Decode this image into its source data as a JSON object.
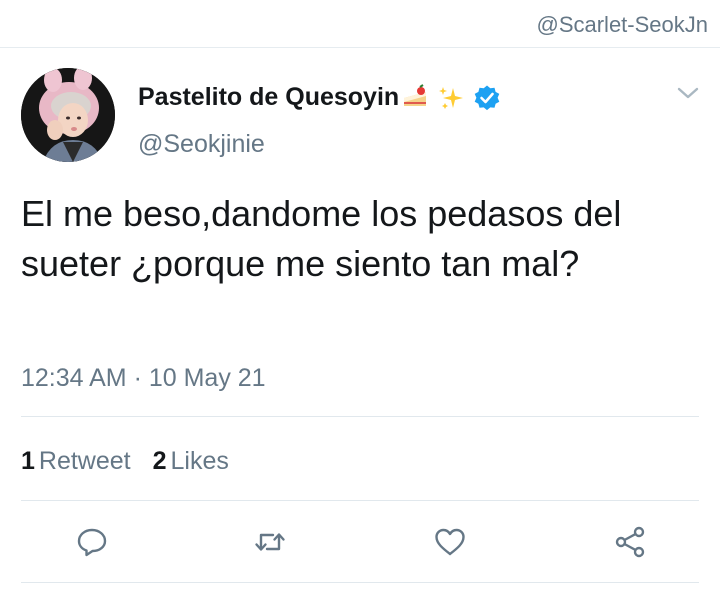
{
  "watermark": "@Scarlet-SeokJn",
  "tweet": {
    "display_name": "Pastelito de Quesoyin",
    "name_emojis": [
      "shortcake-emoji",
      "sparkles-emoji"
    ],
    "verified": true,
    "handle": "@Seokjinie",
    "text": "El me beso,dandome los pedasos del sueter ¿porque me siento tan mal?",
    "timestamp": "12:34 AM · 10 May 21",
    "stats": {
      "retweets_count": "1",
      "retweets_label": "Retweet",
      "likes_count": "2",
      "likes_label": "Likes"
    },
    "actions": [
      "reply-icon",
      "retweet-icon",
      "like-icon",
      "share-icon"
    ]
  },
  "colors": {
    "primary_text": "#14171a",
    "secondary_text": "#657786",
    "verified_blue": "#1da1f2",
    "divider": "#e1e8ed"
  }
}
